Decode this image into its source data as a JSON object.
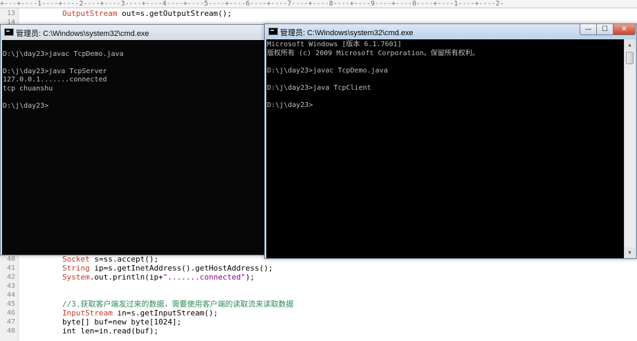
{
  "editor": {
    "ruler_text": "+---+----1----+----2----+----3----+----4----+----5----+----6----+----7----+----8----+----9----+----0----+----1----+----2-",
    "lines": [
      {
        "num": "13",
        "parts": [
          {
            "t": "OutputStream",
            "c": "k"
          },
          {
            "t": " out=s.getOutputStream();",
            "c": "p"
          }
        ]
      },
      {
        "num": "14",
        "parts": []
      },
      {
        "num": "40",
        "parts": [
          {
            "t": "Socket",
            "c": "k"
          },
          {
            "t": " s=ss.accept();",
            "c": "p"
          }
        ]
      },
      {
        "num": "41",
        "parts": [
          {
            "t": "String",
            "c": "k"
          },
          {
            "t": " ip=s.getInetAddress().getHostAddress();",
            "c": "p"
          }
        ]
      },
      {
        "num": "42",
        "parts": [
          {
            "t": "System",
            "c": "k"
          },
          {
            "t": ".out.println(ip+",
            "c": "p"
          },
          {
            "t": "\".......connected\"",
            "c": "s"
          },
          {
            "t": ");",
            "c": "p"
          }
        ]
      },
      {
        "num": "43",
        "parts": []
      },
      {
        "num": "44",
        "parts": []
      },
      {
        "num": "45",
        "parts": [
          {
            "t": "//3.获取客户端发过来的数据，需要使用客户端的读取流来读取数据",
            "c": "c"
          }
        ]
      },
      {
        "num": "46",
        "parts": [
          {
            "t": "InputStream",
            "c": "k"
          },
          {
            "t": " in=s.getInputStream();",
            "c": "p"
          }
        ]
      },
      {
        "num": "47",
        "parts": [
          {
            "t": "byte[] buf=new byte[1024];",
            "c": "p"
          }
        ]
      },
      {
        "num": "48",
        "parts": [
          {
            "t": "int len=in.read(buf);",
            "c": "p"
          }
        ]
      }
    ]
  },
  "server_window": {
    "title": "管理员: C:\\Windows\\system32\\cmd.exe",
    "lines": [
      "",
      "D:\\j\\day23>javac TcpDemo.java",
      "",
      "D:\\j\\day23>java TcpServer",
      "127.0.0.1.......connected",
      "tcp chuanshu",
      "",
      "D:\\j\\day23>"
    ]
  },
  "client_window": {
    "title": "管理员: C:\\Windows\\system32\\cmd.exe",
    "buttons": {
      "minimize": "—",
      "maximize": "☐",
      "close": "✕"
    },
    "lines": [
      "Microsoft Windows [版本 6.1.7601]",
      "版权所有 (c) 2009 Microsoft Corporation。保留所有权利。",
      "",
      "D:\\j\\day23>javac TcpDemo.java",
      "",
      "D:\\j\\day23>java TcpClient",
      "",
      "D:\\j\\day23>"
    ],
    "scroll_up": "▲",
    "scroll_down": "▼"
  }
}
